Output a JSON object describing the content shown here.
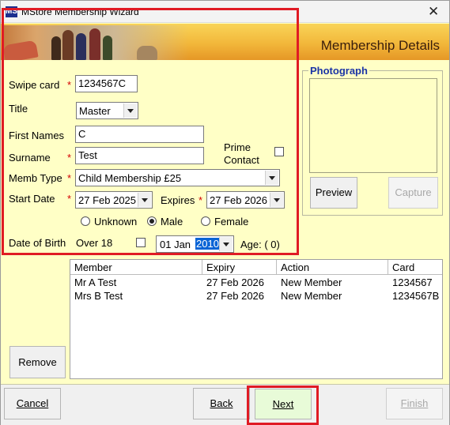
{
  "window": {
    "title": "MStore Membership Wizard",
    "app_icon": "MS"
  },
  "banner": {
    "title": "Membership Details"
  },
  "form": {
    "swipe_card": {
      "label": "Swipe card",
      "value": "1234567C"
    },
    "title": {
      "label": "Title",
      "value": "Master"
    },
    "first_names": {
      "label": "First Names",
      "value": "C"
    },
    "surname": {
      "label": "Surname",
      "value": "Test"
    },
    "prime_contact": {
      "label_line1": "Prime",
      "label_line2": "Contact",
      "checked": false
    },
    "memb_type": {
      "label": "Memb Type",
      "value": "Child Membership £25"
    },
    "start_date": {
      "label": "Start Date",
      "value": "27 Feb  2025"
    },
    "expires": {
      "label": "Expires",
      "value": "27 Feb  2026"
    },
    "gender": {
      "options": [
        "Unknown",
        "Male",
        "Female"
      ],
      "selected": "Male"
    },
    "dob": {
      "label": "Date of Birth",
      "over18_label": "Over 18",
      "over18_checked": false,
      "day_month": "01  Jan",
      "year": "2010",
      "age_label": "Age:  ( 0)"
    },
    "required_mark": "*"
  },
  "photograph": {
    "title": "Photograph",
    "preview_label": "Preview",
    "capture_label": "Capture"
  },
  "members_table": {
    "columns": [
      "Member",
      "Expiry",
      "Action",
      "Card"
    ],
    "rows": [
      [
        "Mr A Test",
        "27 Feb 2026",
        "New Member",
        "1234567"
      ],
      [
        "Mrs B Test",
        "27 Feb 2026",
        "New Member",
        "1234567B"
      ]
    ]
  },
  "remove_label": "Remove",
  "footer": {
    "cancel_label": "Cancel",
    "back_label": "Back",
    "next_label": "Next",
    "finish_label": "Finish"
  },
  "colors": {
    "form_bg": "#ffffc6",
    "highlight": "#e01b24",
    "next_button_bg": "#e8fbd8",
    "group_title": "#1a33a6"
  }
}
